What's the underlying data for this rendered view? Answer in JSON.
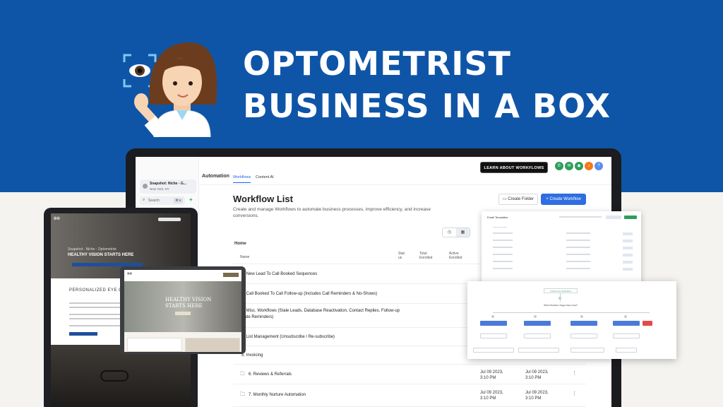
{
  "banner": {
    "title_line1": "OPTOMETRIST",
    "title_line2": "BUSINESS IN A BOX",
    "background": "#0f55a7"
  },
  "icons": {
    "eye": "eye-icon",
    "avatar": "optometrist-avatar"
  },
  "app": {
    "location_name": "Snapshot: Niche - G...",
    "location_sub": "New York, NY",
    "search_label": "Search",
    "search_shortcut": "⌘ K",
    "section": "Automation",
    "tabs": [
      "Workflows",
      "Content AI"
    ],
    "learn_button": "LEARN ABOUT WORKFLOWS",
    "title": "Workflow List",
    "description": "Create and manage Workflows to automate business processes, improve efficiency, and increase conversions.",
    "create_folder": "Create Folder",
    "create_workflow": "+ Create Workflow",
    "breadcrumb": "Home",
    "columns": [
      "Name",
      "Stat us",
      "Total Enrolled",
      "Active Enrolled"
    ],
    "rows": [
      {
        "name": "1. New Lead To Call Booked Sequences"
      },
      {
        "name": "2. Call Booked To Call Follow-up (Includes Call Reminders & No-Shows)"
      },
      {
        "name": "3. Misc. Workflows (Stale Leads, Database Reactivation, Contact Replies, Follow-up Date Reminders)"
      },
      {
        "name": "4. List Management (Unsubscribe / Re-subscribe)"
      },
      {
        "name": "5. Invoicing"
      },
      {
        "name": "6. Reviews & Referrals",
        "date1": "Jul 09 2023, 3:10 PM",
        "date2": "Jul 09 2023, 3:10 PM"
      },
      {
        "name": "7. Monthly Nurture Automation",
        "date1": "Jul 09 2023, 3:10 PM",
        "date2": "Jul 09 2023, 3:10 PM"
      }
    ],
    "accent": "#2f6de1"
  },
  "email_panel": {
    "title": "Email Templates"
  },
  "flow_panel": {
    "node_top": "Invite Form Submitted",
    "question": "Which Workflow Trigger Was Used?"
  },
  "tablet_site": {
    "hero_line1": "Snapshot - Niche - Optometrist",
    "hero_line2": "HEALTHY VISION STARTS HERE",
    "section_title": "PERSONALIZED EYE CARE"
  },
  "window_site": {
    "hero_line1": "HEALTHY VISION",
    "hero_line2": "STARTS HERE"
  }
}
